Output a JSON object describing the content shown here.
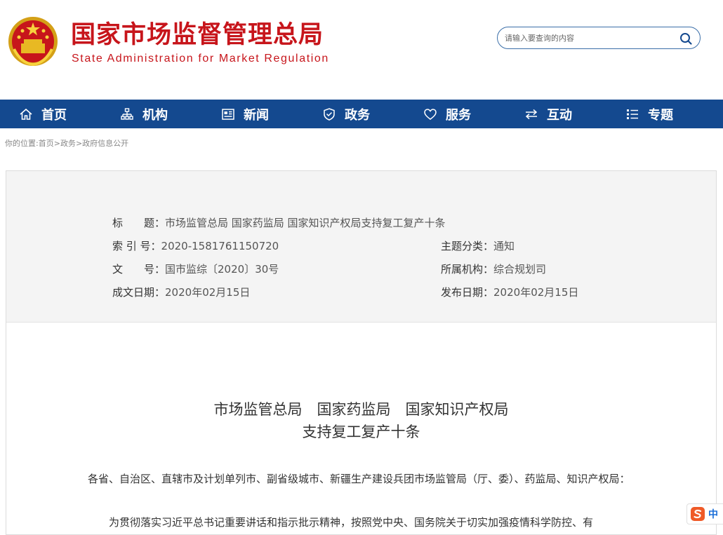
{
  "header": {
    "title_cn": "国家市场监督管理总局",
    "title_en": "State Administration for Market Regulation",
    "search_placeholder": "请输入要查询的内容",
    "search_icon": "search-icon"
  },
  "nav": [
    {
      "label": "首页",
      "icon": "home-icon"
    },
    {
      "label": "机构",
      "icon": "org-chart-icon"
    },
    {
      "label": "新闻",
      "icon": "news-icon"
    },
    {
      "label": "政务",
      "icon": "shield-icon"
    },
    {
      "label": "服务",
      "icon": "heart-icon"
    },
    {
      "label": "互动",
      "icon": "swap-arrows-icon"
    },
    {
      "label": "专题",
      "icon": "list-icon"
    }
  ],
  "breadcrumb": {
    "prefix": "你的位置:",
    "items": [
      "首页",
      "政务",
      "政府信息公开"
    ],
    "separator": ">"
  },
  "meta": {
    "title_label": "标　　题：",
    "title_value": "市场监管总局 国家药监局 国家知识产权局支持复工复产十条",
    "index_label": "索 引 号：",
    "index_value": "2020-1581761150720",
    "category_label": "主题分类：",
    "category_value": "通知",
    "docno_label": "文　　号：",
    "docno_value": "国市监综〔2020〕30号",
    "org_label": "所属机构：",
    "org_value": "综合规划司",
    "created_label": "成文日期：",
    "created_value": "2020年02月15日",
    "published_label": "发布日期：",
    "published_value": "2020年02月15日"
  },
  "document": {
    "title_line1": "市场监管总局　国家药监局　国家知识产权局",
    "title_line2": "支持复工复产十条",
    "para1": "各省、自治区、直辖市及计划单列市、副省级城市、新疆生产建设兵团市场监管局（厅、委）、药监局、知识产权局：",
    "para2": "　　为贯彻落实习近平总书记重要讲话和指示批示精神，按照党中央、国务院关于切实加强疫情科学防控、有"
  },
  "ime": {
    "label": "中"
  },
  "colors": {
    "brand_red": "#c7151b",
    "nav_blue": "#14498f",
    "search_border": "#3a6ea8"
  }
}
